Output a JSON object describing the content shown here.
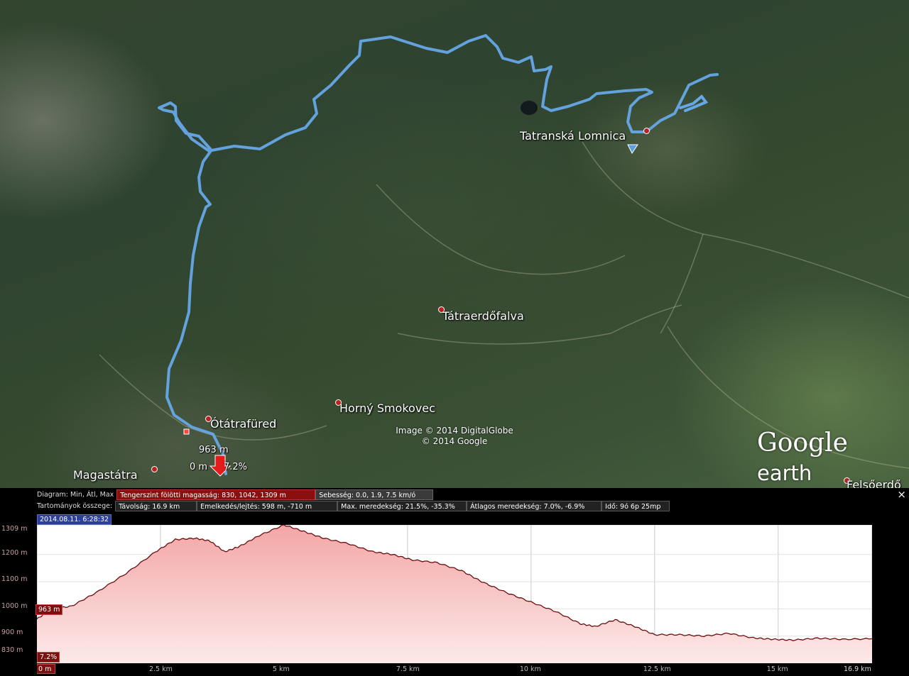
{
  "map": {
    "places": [
      {
        "id": "tatranska-lomnica",
        "label": "Tatranská Lomnica"
      },
      {
        "id": "tatraerdofalva",
        "label": "Tátraerdőfalva"
      },
      {
        "id": "horny-smokovec",
        "label": "Horný Smokovec"
      },
      {
        "id": "otatrafured",
        "label": "Ótátrafüred"
      },
      {
        "id": "magastatra",
        "label": "Magastátra"
      },
      {
        "id": "felsoerdo",
        "label": "Felsőerdő"
      }
    ],
    "attribution_line1": "Image © 2014 DigitalGlobe",
    "attribution_line2": "© 2014 Google",
    "logo_google": "Google",
    "logo_earth": "earth",
    "cursor": {
      "elevation": "963 m",
      "distance": "0 m",
      "grade": "7.2%"
    }
  },
  "panel": {
    "row1": {
      "label": "Diagram: Min, Átl, Max",
      "elevation": "Tengerszint fölötti magasság: 830, 1042, 1309 m",
      "speed": "Sebesség: 0.0, 1.9, 7.5 km/ó"
    },
    "row2": {
      "label": "Tartományok összege:",
      "distance": "Távolság: 16.9 km",
      "gain": "Emelkedés/lejtés: 598 m, -710 m",
      "max_slope": "Max. meredekség: 21.5%, -35.3%",
      "avg_slope": "Átlagos meredekség: 7.0%, -6.9%",
      "time": "Idő: 9ó 6p 25mp"
    },
    "date": "2014.08.11. 6:28:32",
    "close": "×",
    "cursor_elev": "963 m",
    "cursor_grade": "7.2%",
    "cursor_dist": "0 m"
  },
  "chart_data": {
    "type": "area",
    "xlabel": "",
    "ylabel": "",
    "x_ticks": [
      "0 m",
      "2.5 km",
      "5 km",
      "7.5 km",
      "10 km",
      "12.5 km",
      "15 km",
      "16.9 km"
    ],
    "y_ticks": [
      "1309 m",
      "1200 m",
      "1100 m",
      "1000 m",
      "900 m",
      "830 m"
    ],
    "xlim": [
      0,
      16.9
    ],
    "ylim": [
      800,
      1309
    ],
    "grid": true,
    "color_line": "#6b0d0d",
    "color_fill_top": "#f3a6a6",
    "color_fill_bottom": "#fde9e9",
    "x": [
      0,
      0.3,
      0.7,
      1.2,
      1.8,
      2.4,
      2.8,
      3.2,
      3.5,
      3.8,
      4.1,
      4.5,
      5.0,
      5.4,
      5.8,
      6.3,
      6.8,
      7.2,
      7.6,
      8.1,
      8.6,
      9.0,
      9.5,
      10.0,
      10.5,
      11.0,
      11.3,
      11.7,
      12.1,
      12.5,
      13.0,
      13.5,
      14.0,
      14.5,
      14.9,
      15.3,
      15.8,
      16.3,
      16.9
    ],
    "y": [
      963,
      1000,
      1010,
      1060,
      1130,
      1210,
      1255,
      1260,
      1250,
      1210,
      1230,
      1270,
      1309,
      1285,
      1260,
      1240,
      1210,
      1200,
      1180,
      1170,
      1140,
      1100,
      1060,
      1025,
      990,
      945,
      935,
      960,
      935,
      905,
      905,
      900,
      910,
      893,
      888,
      885,
      892,
      888,
      890
    ]
  }
}
